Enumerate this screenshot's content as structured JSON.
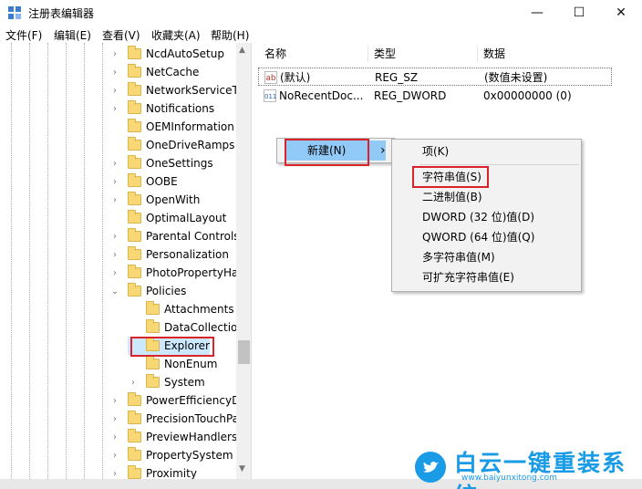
{
  "window": {
    "title": "注册表编辑器",
    "minimize": "—",
    "maximize": "☐",
    "close": "✕"
  },
  "menubar": [
    "文件(F)",
    "编辑(E)",
    "查看(V)",
    "收藏夹(A)",
    "帮助(H)"
  ],
  "tree": {
    "items": [
      {
        "label": "NcdAutoSetup",
        "chevron": "›"
      },
      {
        "label": "NetCache",
        "chevron": "›"
      },
      {
        "label": "NetworkServiceTr",
        "chevron": "›"
      },
      {
        "label": "Notifications",
        "chevron": "›"
      },
      {
        "label": "OEMInformation",
        "chevron": ""
      },
      {
        "label": "OneDriveRamps",
        "chevron": ""
      },
      {
        "label": "OneSettings",
        "chevron": "›"
      },
      {
        "label": "OOBE",
        "chevron": "›"
      },
      {
        "label": "OpenWith",
        "chevron": "›"
      },
      {
        "label": "OptimalLayout",
        "chevron": ""
      },
      {
        "label": "Parental Controls",
        "chevron": "›"
      },
      {
        "label": "Personalization",
        "chevron": "›"
      },
      {
        "label": "PhotoPropertyHa",
        "chevron": "›"
      },
      {
        "label": "Policies",
        "chevron": "⌄"
      },
      {
        "label": "Attachments",
        "chevron": ""
      },
      {
        "label": "DataCollection",
        "chevron": ""
      },
      {
        "label": "Explorer",
        "chevron": ""
      },
      {
        "label": "NonEnum",
        "chevron": ""
      },
      {
        "label": "System",
        "chevron": "›"
      },
      {
        "label": "PowerEfficiencyDi",
        "chevron": "›"
      },
      {
        "label": "PrecisionTouchPa",
        "chevron": "›"
      },
      {
        "label": "PreviewHandlers",
        "chevron": "›"
      },
      {
        "label": "PropertySystem",
        "chevron": "›"
      },
      {
        "label": "Proximity",
        "chevron": "›"
      }
    ]
  },
  "columns": {
    "name": "名称",
    "type": "类型",
    "data": "数据"
  },
  "values": [
    {
      "icon": "ab",
      "name": "(默认)",
      "type": "REG_SZ",
      "data": "(数值未设置)"
    },
    {
      "icon": "011",
      "name": "NoRecentDoc...",
      "type": "REG_DWORD",
      "data": "0x00000000 (0)"
    }
  ],
  "context_menu": {
    "new_label": "新建(N)",
    "new_arrow": "›"
  },
  "submenu": {
    "key": "项(K)",
    "string": "字符串值(S)",
    "binary": "二进制值(B)",
    "dword": "DWORD (32 位)值(D)",
    "qword": "QWORD (64 位)值(Q)",
    "multi": "多字符串值(M)",
    "expand": "可扩充字符串值(E)"
  },
  "scroll": {
    "up": "▲",
    "down": "▼"
  },
  "watermark": {
    "brand": "白云一键重装系统",
    "url": "www.baiyunxitong.com"
  },
  "colors": {
    "highlight_red": "#d9222a",
    "menu_hover": "#91c9f7",
    "brand_blue": "#1a9be6"
  }
}
